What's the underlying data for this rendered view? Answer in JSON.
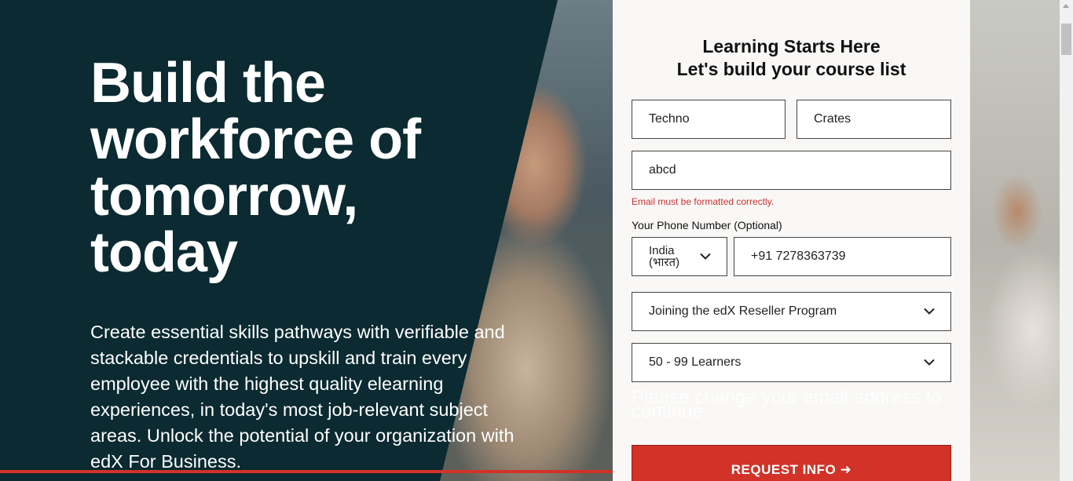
{
  "hero": {
    "title": "Build the workforce of tomorrow, today",
    "description": "Create essential skills pathways with verifiable and stackable credentials to upskill and train every employee with the highest quality elearning experiences, in today's most job-relevant subject areas. Unlock the potential of your organization with edX For Business."
  },
  "form": {
    "heading_line1": "Learning Starts Here",
    "heading_line2": "Let's build your course list",
    "first_name": "Techno",
    "last_name": "Crates",
    "email": "abcd",
    "email_error": "Email must be formatted correctly.",
    "phone_label": "Your Phone Number (Optional)",
    "country": "India (भारत)",
    "phone": "+91 7278363739",
    "interest": "Joining the edX Reseller Program",
    "learners": "50 - 99 Learners",
    "hidden_message": "Please change your email address to continue.",
    "submit_label": "REQUEST INFO ➜"
  },
  "colors": {
    "dark_panel": "#0b2a31",
    "accent_red": "#d23228",
    "form_bg": "#f9f8f6"
  },
  "icons": {
    "select_chevron": "chevron-down-icon",
    "submit_arrow": "arrow-right-icon"
  }
}
